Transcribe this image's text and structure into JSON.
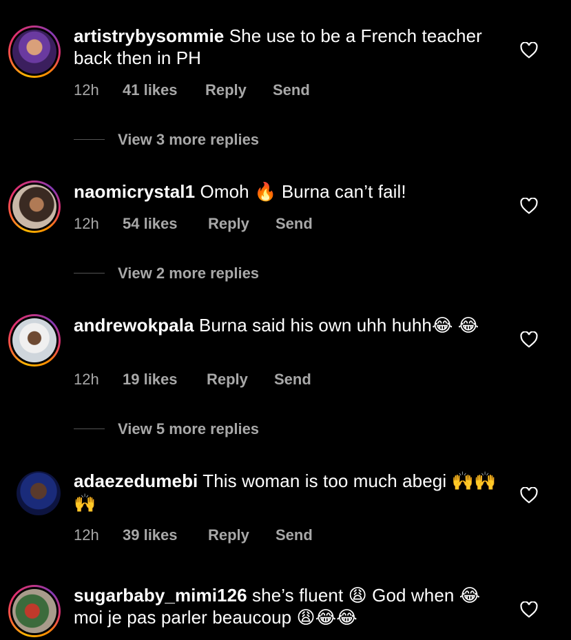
{
  "comments": [
    {
      "username": "artistrybysommie",
      "text": "She use to be a French teacher back then in PH",
      "time": "12h",
      "likes": "41 likes",
      "reply": "Reply",
      "send": "Send",
      "view_replies": "View 3 more replies"
    },
    {
      "username": "naomicrystal1",
      "text": "Omoh 🔥 Burna can’t fail!",
      "time": "12h",
      "likes": "54 likes",
      "reply": "Reply",
      "send": "Send",
      "view_replies": "View 2 more replies"
    },
    {
      "username": "andrewokpala",
      "text": "Burna said his own uhh huhh😂 😂",
      "time": "12h",
      "likes": "19 likes",
      "reply": "Reply",
      "send": "Send",
      "view_replies": "View 5 more replies"
    },
    {
      "username": "adaezedumebi",
      "text": "This woman is too much abegi 🙌🙌🙌",
      "time": "12h",
      "likes": "39 likes",
      "reply": "Reply",
      "send": "Send"
    },
    {
      "username": "sugarbaby_mimi126",
      "text": "she’s fluent 😩 God when 😂moi je pas parler beaucoup 😩😂😂"
    }
  ],
  "icons": {
    "like": "heart-icon"
  },
  "colors": {
    "background": "#000000",
    "text": "#ffffff",
    "secondary_text": "#a8a8a8"
  }
}
